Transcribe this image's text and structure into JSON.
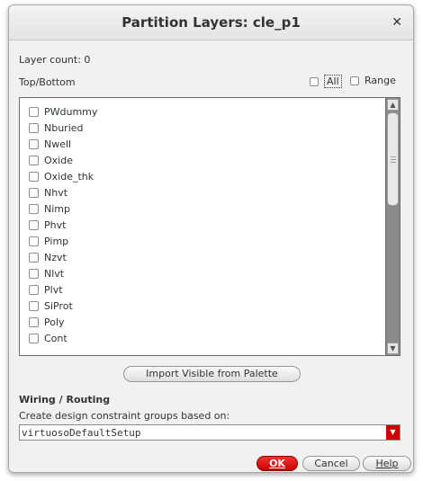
{
  "window": {
    "title": "Partition Layers: cle_p1",
    "close_glyph": "✕"
  },
  "layer_count_label": "Layer count: 0",
  "top_bottom_label": "Top/Bottom",
  "all_checkbox": {
    "label": "All",
    "checked": false
  },
  "range_checkbox": {
    "label": "Range",
    "checked": false
  },
  "layers": [
    {
      "label": "PWdummy",
      "checked": false
    },
    {
      "label": "Nburied",
      "checked": false
    },
    {
      "label": "Nwell",
      "checked": false
    },
    {
      "label": "Oxide",
      "checked": false
    },
    {
      "label": "Oxide_thk",
      "checked": false
    },
    {
      "label": "Nhvt",
      "checked": false
    },
    {
      "label": "Nimp",
      "checked": false
    },
    {
      "label": "Phvt",
      "checked": false
    },
    {
      "label": "Pimp",
      "checked": false
    },
    {
      "label": "Nzvt",
      "checked": false
    },
    {
      "label": "Nlvt",
      "checked": false
    },
    {
      "label": "Plvt",
      "checked": false
    },
    {
      "label": "SiProt",
      "checked": false
    },
    {
      "label": "Poly",
      "checked": false
    },
    {
      "label": "Cont",
      "checked": false
    }
  ],
  "import_button_label": "Import Visible from Palette",
  "wiring_heading": "Wiring / Routing",
  "constraint_label": "Create design constraint groups based on:",
  "constraint_select": {
    "value": "virtuosoDefaultSetup"
  },
  "buttons": {
    "ok": "OK",
    "cancel": "Cancel",
    "help": "Help"
  },
  "colors": {
    "accent": "#cc0000",
    "scrollbar_track": "#8a8a8a"
  }
}
